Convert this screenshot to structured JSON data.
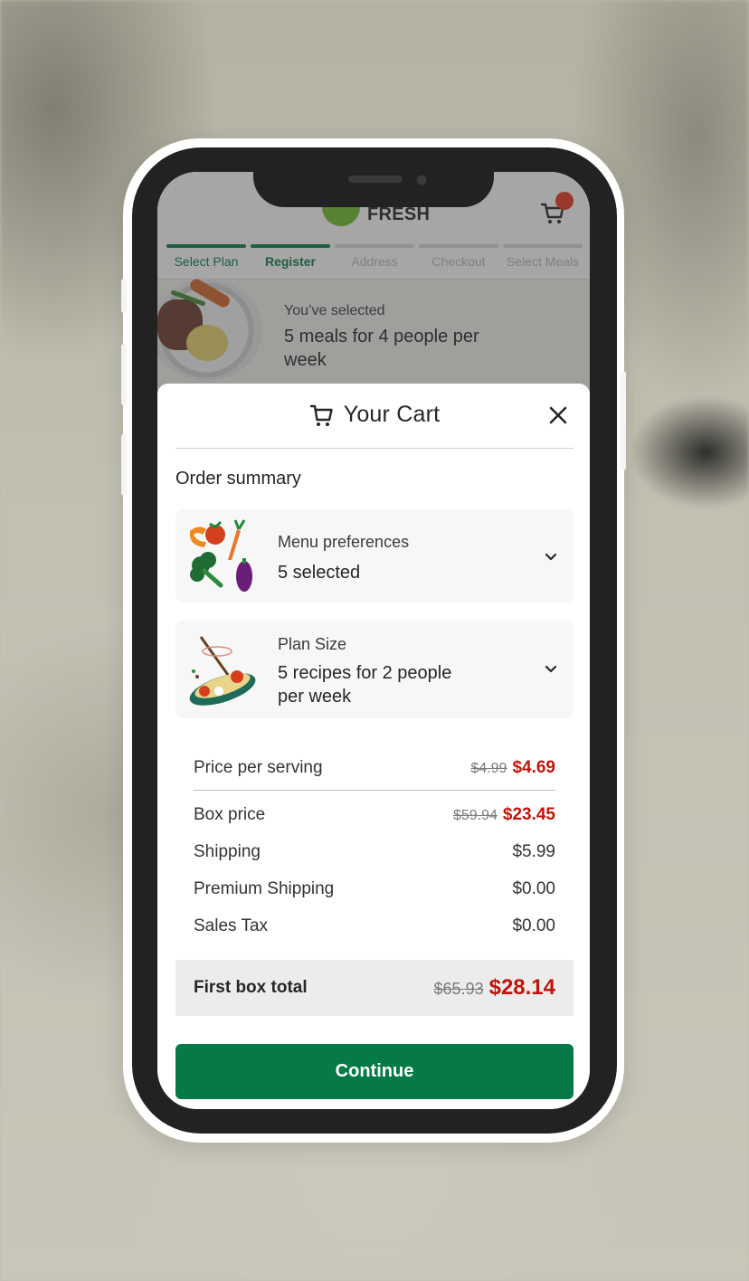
{
  "header": {
    "logo_text": "FRESH",
    "cart_icon": "shopping-cart-icon",
    "cart_badge_color": "#e8361f"
  },
  "progress_steps": [
    {
      "label": "Select Plan",
      "state": "complete"
    },
    {
      "label": "Register",
      "state": "current"
    },
    {
      "label": "Address",
      "state": "upcoming"
    },
    {
      "label": "Checkout",
      "state": "upcoming"
    },
    {
      "label": "Select Meals",
      "state": "upcoming"
    }
  ],
  "selection_banner": {
    "caption": "You’ve selected",
    "summary": "5 meals for 4 people per week"
  },
  "cart": {
    "title": "Your Cart",
    "title_icon": "shopping-cart-icon",
    "close_icon": "close-icon",
    "section_title": "Order summary",
    "accordions": [
      {
        "label": "Menu preferences",
        "value": "5 selected",
        "icon": "vegetables-illustration",
        "chevron": "chevron-down-icon"
      },
      {
        "label": "Plan Size",
        "value": "5 recipes for 2 people per week",
        "icon": "cooking-pan-illustration",
        "chevron": "chevron-down-icon"
      }
    ],
    "price_rows": [
      {
        "label": "Price per serving",
        "old": "$4.99",
        "value": "$4.69"
      },
      {
        "label": "Box price",
        "old": "$59.94",
        "value": "$23.45"
      },
      {
        "label": "Shipping",
        "value": "$5.99"
      },
      {
        "label": "Premium Shipping",
        "value": "$0.00"
      },
      {
        "label": "Sales Tax",
        "value": "$0.00"
      }
    ],
    "total": {
      "label": "First box total",
      "old": "$65.93",
      "value": "$28.14"
    },
    "continue_label": "Continue"
  },
  "colors": {
    "brand_green": "#067a46",
    "discount_red": "#c0140c",
    "logo_green": "#6fba2c"
  }
}
